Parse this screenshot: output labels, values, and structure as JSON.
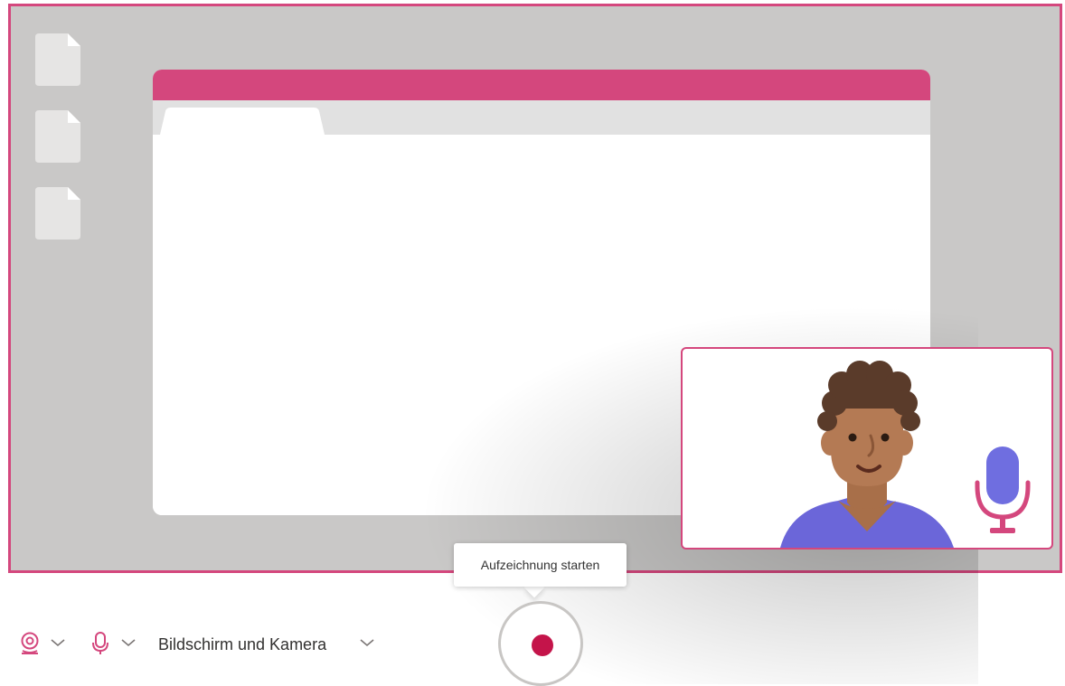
{
  "tooltip": {
    "text": "Aufzeichnung starten"
  },
  "toolbar": {
    "camera_icon": "webcam-icon",
    "mic_icon": "microphone-icon",
    "chevron_icon": "chevron-down-icon",
    "mode_label": "Bildschirm und Kamera"
  },
  "record_button": {
    "icon": "record-dot"
  },
  "colors": {
    "accent": "#d4477d",
    "record": "#c4144a",
    "desktop": "#c9c8c7",
    "mic": "#6f6ee0",
    "shirt": "#6b66d9",
    "skin": "#b47a54",
    "hair": "#5a3b2a"
  }
}
